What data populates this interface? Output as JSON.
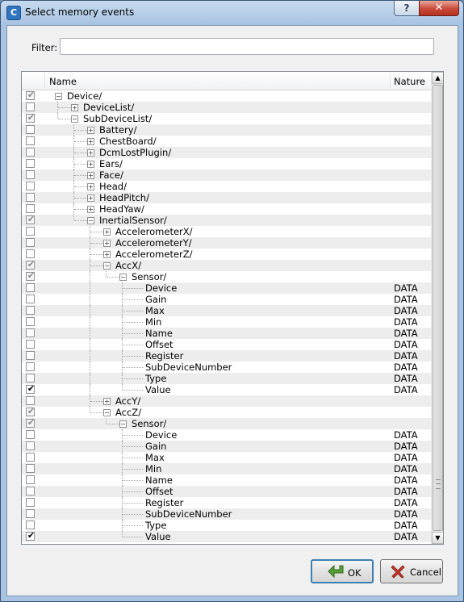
{
  "window": {
    "title": "Select memory events",
    "app_icon_letter": "C",
    "help_label": "?",
    "close_label": "✕"
  },
  "filter": {
    "label": "Filter:",
    "value": "",
    "placeholder": ""
  },
  "tree": {
    "columns": {
      "name": "Name",
      "nature": "Nature"
    },
    "rows": [
      {
        "label": "Device/",
        "depth": 0,
        "expander": "minus",
        "check": "gray",
        "nature": ""
      },
      {
        "label": "DeviceList/",
        "depth": 1,
        "expander": "plus",
        "check": "none",
        "nature": ""
      },
      {
        "label": "SubDeviceList/",
        "depth": 1,
        "expander": "minus",
        "check": "gray",
        "nature": ""
      },
      {
        "label": "Battery/",
        "depth": 2,
        "expander": "plus",
        "check": "none",
        "nature": ""
      },
      {
        "label": "ChestBoard/",
        "depth": 2,
        "expander": "plus",
        "check": "none",
        "nature": ""
      },
      {
        "label": "DcmLostPlugin/",
        "depth": 2,
        "expander": "plus",
        "check": "none",
        "nature": ""
      },
      {
        "label": "Ears/",
        "depth": 2,
        "expander": "plus",
        "check": "none",
        "nature": ""
      },
      {
        "label": "Face/",
        "depth": 2,
        "expander": "plus",
        "check": "none",
        "nature": ""
      },
      {
        "label": "Head/",
        "depth": 2,
        "expander": "plus",
        "check": "none",
        "nature": ""
      },
      {
        "label": "HeadPitch/",
        "depth": 2,
        "expander": "plus",
        "check": "none",
        "nature": ""
      },
      {
        "label": "HeadYaw/",
        "depth": 2,
        "expander": "plus",
        "check": "none",
        "nature": ""
      },
      {
        "label": "InertialSensor/",
        "depth": 2,
        "expander": "minus",
        "check": "gray",
        "nature": ""
      },
      {
        "label": "AccelerometerX/",
        "depth": 3,
        "expander": "plus",
        "check": "none",
        "nature": ""
      },
      {
        "label": "AccelerometerY/",
        "depth": 3,
        "expander": "plus",
        "check": "none",
        "nature": ""
      },
      {
        "label": "AccelerometerZ/",
        "depth": 3,
        "expander": "plus",
        "check": "none",
        "nature": ""
      },
      {
        "label": "AccX/",
        "depth": 3,
        "expander": "minus",
        "check": "gray",
        "nature": ""
      },
      {
        "label": "Sensor/",
        "depth": 4,
        "expander": "minus",
        "check": "gray",
        "nature": ""
      },
      {
        "label": "Device",
        "depth": 5,
        "expander": "leaf",
        "check": "none",
        "nature": "DATA"
      },
      {
        "label": "Gain",
        "depth": 5,
        "expander": "leaf",
        "check": "none",
        "nature": "DATA"
      },
      {
        "label": "Max",
        "depth": 5,
        "expander": "leaf",
        "check": "none",
        "nature": "DATA"
      },
      {
        "label": "Min",
        "depth": 5,
        "expander": "leaf",
        "check": "none",
        "nature": "DATA"
      },
      {
        "label": "Name",
        "depth": 5,
        "expander": "leaf",
        "check": "none",
        "nature": "DATA"
      },
      {
        "label": "Offset",
        "depth": 5,
        "expander": "leaf",
        "check": "none",
        "nature": "DATA"
      },
      {
        "label": "Register",
        "depth": 5,
        "expander": "leaf",
        "check": "none",
        "nature": "DATA"
      },
      {
        "label": "SubDeviceNumber",
        "depth": 5,
        "expander": "leaf",
        "check": "none",
        "nature": "DATA"
      },
      {
        "label": "Type",
        "depth": 5,
        "expander": "leaf",
        "check": "none",
        "nature": "DATA"
      },
      {
        "label": "Value",
        "depth": 5,
        "expander": "leaf",
        "check": "black",
        "nature": "DATA"
      },
      {
        "label": "AccY/",
        "depth": 3,
        "expander": "plus",
        "check": "none",
        "nature": ""
      },
      {
        "label": "AccZ/",
        "depth": 3,
        "expander": "minus",
        "check": "gray",
        "nature": ""
      },
      {
        "label": "Sensor/",
        "depth": 4,
        "expander": "minus",
        "check": "gray",
        "nature": ""
      },
      {
        "label": "Device",
        "depth": 5,
        "expander": "leaf",
        "check": "none",
        "nature": "DATA"
      },
      {
        "label": "Gain",
        "depth": 5,
        "expander": "leaf",
        "check": "none",
        "nature": "DATA"
      },
      {
        "label": "Max",
        "depth": 5,
        "expander": "leaf",
        "check": "none",
        "nature": "DATA"
      },
      {
        "label": "Min",
        "depth": 5,
        "expander": "leaf",
        "check": "none",
        "nature": "DATA"
      },
      {
        "label": "Name",
        "depth": 5,
        "expander": "leaf",
        "check": "none",
        "nature": "DATA"
      },
      {
        "label": "Offset",
        "depth": 5,
        "expander": "leaf",
        "check": "none",
        "nature": "DATA"
      },
      {
        "label": "Register",
        "depth": 5,
        "expander": "leaf",
        "check": "none",
        "nature": "DATA"
      },
      {
        "label": "SubDeviceNumber",
        "depth": 5,
        "expander": "leaf",
        "check": "none",
        "nature": "DATA"
      },
      {
        "label": "Type",
        "depth": 5,
        "expander": "leaf",
        "check": "none",
        "nature": "DATA"
      },
      {
        "label": "Value",
        "depth": 5,
        "expander": "leaf",
        "check": "black",
        "nature": "DATA"
      }
    ]
  },
  "buttons": {
    "ok_label": "OK",
    "cancel_label": "Cancel"
  }
}
